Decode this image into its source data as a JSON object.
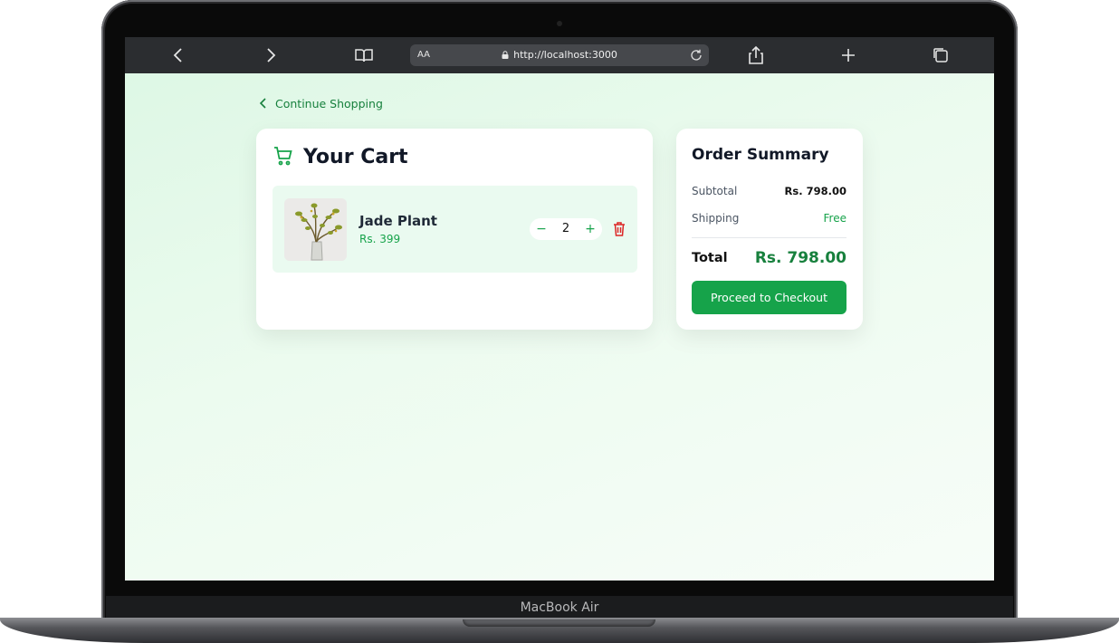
{
  "device": {
    "brand_label": "MacBook Air"
  },
  "browser": {
    "url": "http://localhost:3000",
    "reader_label": "AA",
    "icons": [
      "back-icon",
      "forward-icon",
      "book-icon",
      "lock-icon",
      "reload-icon",
      "share-icon",
      "new-tab-icon",
      "tabs-icon"
    ]
  },
  "nav": {
    "continue_label": "Continue Shopping"
  },
  "cart": {
    "title": "Your Cart",
    "items": [
      {
        "name": "Jade Plant",
        "price": "Rs. 399",
        "quantity": "2",
        "minus": "−",
        "plus": "+"
      }
    ]
  },
  "summary": {
    "title": "Order Summary",
    "subtotal_label": "Subtotal",
    "subtotal_value": "Rs. 798.00",
    "shipping_label": "Shipping",
    "shipping_value": "Free",
    "total_label": "Total",
    "total_value": "Rs. 798.00",
    "checkout_label": "Proceed to Checkout"
  },
  "colors": {
    "accent": "#16a34a",
    "accent_dark": "#17803d",
    "danger": "#dc2626",
    "page_bg": "#e6f9ec"
  }
}
